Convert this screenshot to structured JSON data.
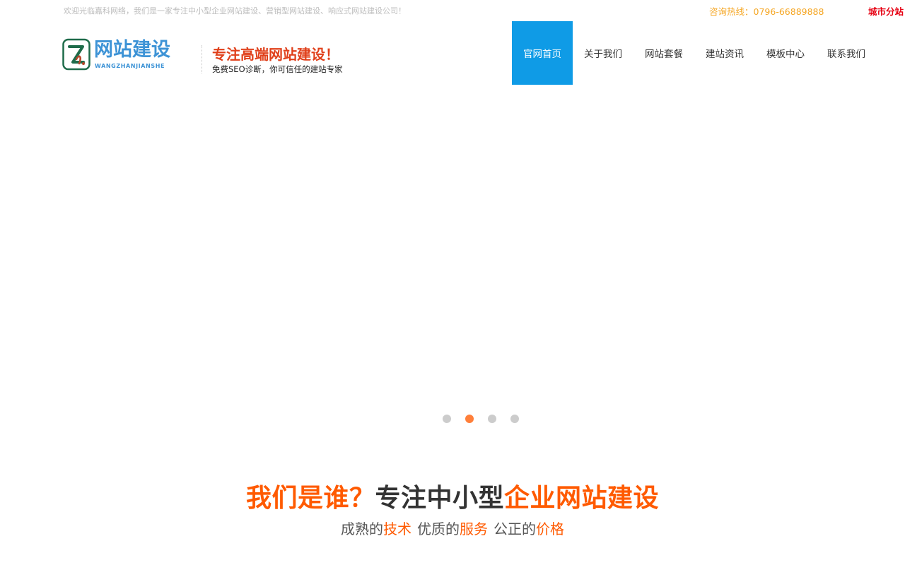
{
  "topbar": {
    "welcome": "欢迎光临嘉科网络，我们是一家专注中小型企业网站建设、营销型网站建设、响应式网站建设公司！",
    "hotline_label": "咨询热线：",
    "hotline_number": "0796-66889888",
    "city_link": "城市分站"
  },
  "header": {
    "logo_text": "网站建设",
    "logo_sub": "WANGZHANJIANSHE",
    "slogan": "专注高端网站建设！",
    "slogan_sub": "免费SEO诊断，你可信任的建站专家"
  },
  "nav": {
    "items": [
      "官网首页",
      "关于我们",
      "网站套餐",
      "建站资讯",
      "模板中心",
      "联系我们"
    ],
    "active_index": 0
  },
  "banner": {
    "dot_count": 4,
    "active_dot": 1
  },
  "section": {
    "title_part1": "我们是谁？",
    "title_part2": "专注中小型",
    "title_part3": "企业网站建设",
    "sub": {
      "p1": "成熟的",
      "h1": "技术",
      "p2": "优质的",
      "h2": "服务",
      "p3": "公正的",
      "h3": "价格"
    }
  },
  "colors": {
    "nav_active": "#0f9be6",
    "accent_orange": "#ff5a00",
    "slogan_red": "#e0401b",
    "hotline": "#f5a623",
    "city": "#e60012"
  }
}
